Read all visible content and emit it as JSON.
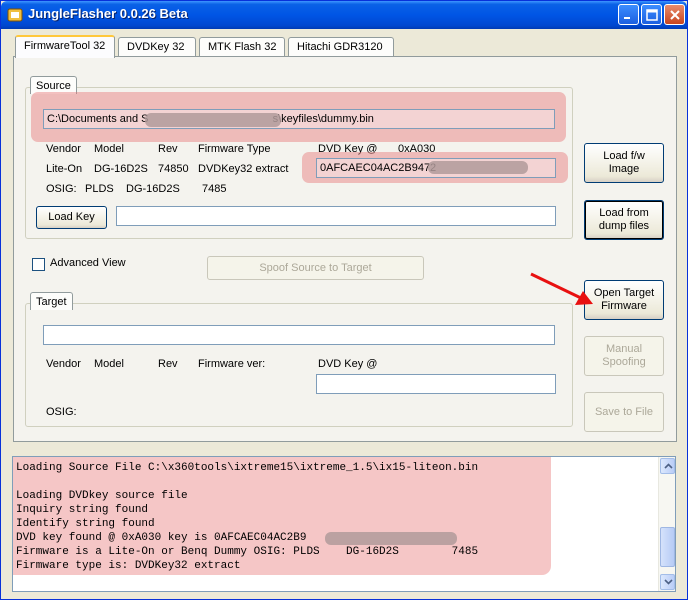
{
  "window": {
    "title": "JungleFlasher 0.0.26 Beta"
  },
  "tabs": [
    "FirmwareTool 32",
    "DVDKey 32",
    "MTK Flash 32",
    "Hitachi GDR3120"
  ],
  "source": {
    "group_label": "Source",
    "path_visible_start": "C:\\Documents and S",
    "path_visible_end": "s\\keyfiles\\dummy.bin",
    "headers": {
      "vendor": "Vendor",
      "model": "Model",
      "rev": "Rev",
      "fw_type": "Firmware Type",
      "dvd_key": "DVD Key @",
      "key_addr": "0xA030"
    },
    "values": {
      "vendor": "Lite-On",
      "model": "DG-16D2S",
      "rev": "74850",
      "fw_type": "DVDKey32 extract"
    },
    "dvd_key_visible": "0AFCAEC04AC2B9472",
    "osig_label": "OSIG:",
    "osig_values": [
      "PLDS",
      "DG-16D2S",
      "7485"
    ],
    "load_key_button": "Load Key",
    "key_value": ""
  },
  "advanced_view": {
    "label": "Advanced View",
    "checked": false
  },
  "spoof_button": "Spoof Source to Target",
  "target": {
    "group_label": "Target",
    "path_value": "",
    "headers": {
      "vendor": "Vendor",
      "model": "Model",
      "rev": "Rev",
      "fw_ver": "Firmware ver:",
      "dvd_key": "DVD Key @"
    },
    "dvd_key_value": "",
    "osig_label": "OSIG:"
  },
  "side_buttons": {
    "load_fw_image": "Load f/w\nImage",
    "load_dump": "Load from\ndump files",
    "open_target": "Open Target\nFirmware",
    "manual_spoofing": "Manual\nSpoofing",
    "save_to_file": "Save to File"
  },
  "log": [
    "Loading Source File C:\\x360tools\\ixtreme15\\ixtreme_1.5\\ix15-liteon.bin",
    "",
    "Loading DVDkey source file",
    "Inquiry string found",
    "Identify string found",
    "DVD key found @ 0xA030 key is 0AFCAEC04AC2B9",
    "Firmware is a Lite-On or Benq Dummy OSIG: PLDS    DG-16D2S        7485",
    "Firmware type is: DVDKey32 extract"
  ],
  "colors": {
    "highlight": "#e67878",
    "titlebar": "#0055e5",
    "arrow": "#e81010"
  }
}
